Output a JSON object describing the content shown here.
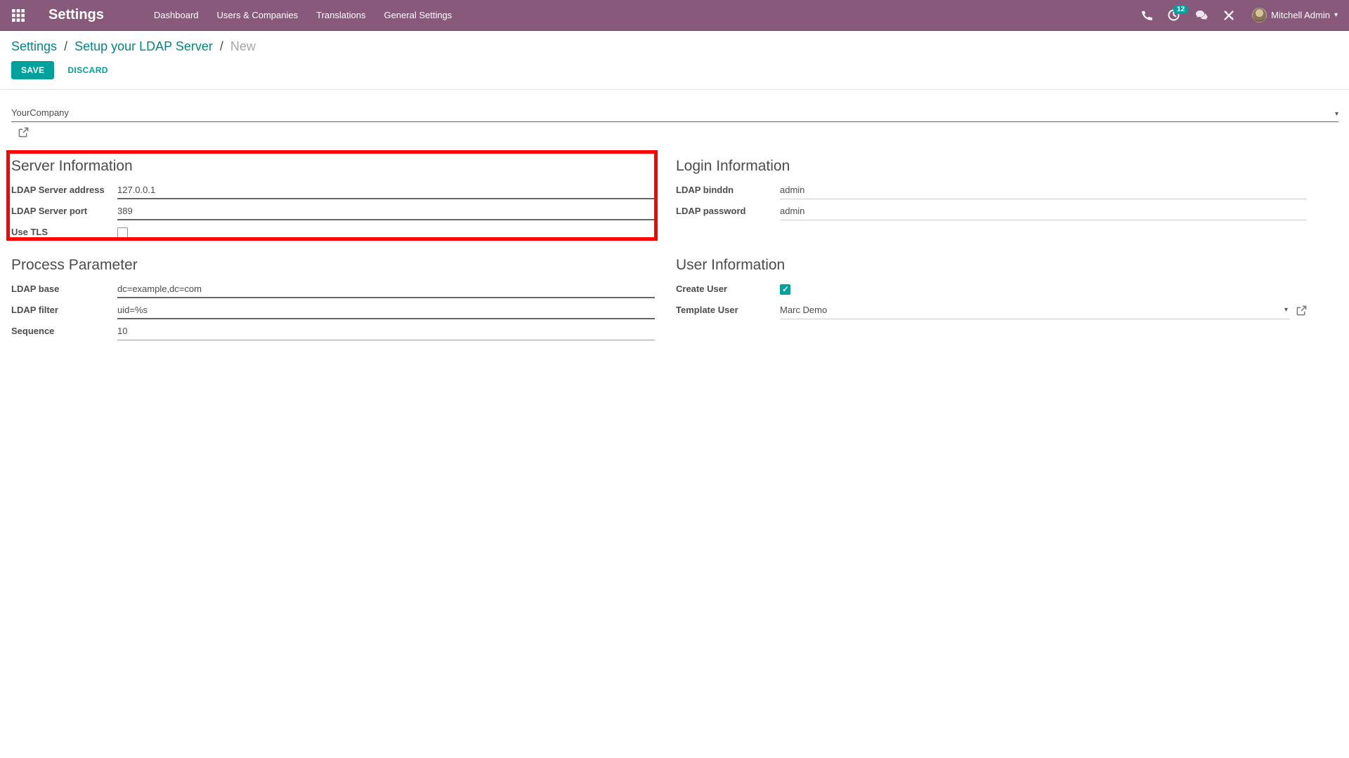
{
  "navbar": {
    "app_title": "Settings",
    "menu": [
      "Dashboard",
      "Users & Companies",
      "Translations",
      "General Settings"
    ],
    "activity_count": "12",
    "user_name": "Mitchell Admin"
  },
  "breadcrumb": {
    "links": [
      "Settings",
      "Setup your LDAP Server"
    ],
    "current": "New",
    "separator": "/"
  },
  "buttons": {
    "save": "SAVE",
    "discard": "DISCARD"
  },
  "form": {
    "company": {
      "value": "YourCompany"
    },
    "server": {
      "title": "Server Information",
      "address_label": "LDAP Server address",
      "address_value": "127.0.0.1",
      "port_label": "LDAP Server port",
      "port_value": "389",
      "tls_label": "Use TLS",
      "tls_checked": false
    },
    "login": {
      "title": "Login Information",
      "binddn_label": "LDAP binddn",
      "binddn_value": "admin",
      "password_label": "LDAP password",
      "password_value": "admin"
    },
    "process": {
      "title": "Process Parameter",
      "base_label": "LDAP base",
      "base_value": "dc=example,dc=com",
      "filter_label": "LDAP filter",
      "filter_value": "uid=%s",
      "sequence_label": "Sequence",
      "sequence_value": "10"
    },
    "user": {
      "title": "User Information",
      "create_label": "Create User",
      "create_checked": true,
      "template_label": "Template User",
      "template_value": "Marc Demo"
    }
  },
  "colors": {
    "navbar": "#875A7B",
    "accent": "#00A09D",
    "link": "#008784",
    "annotation": "#FF0000"
  }
}
